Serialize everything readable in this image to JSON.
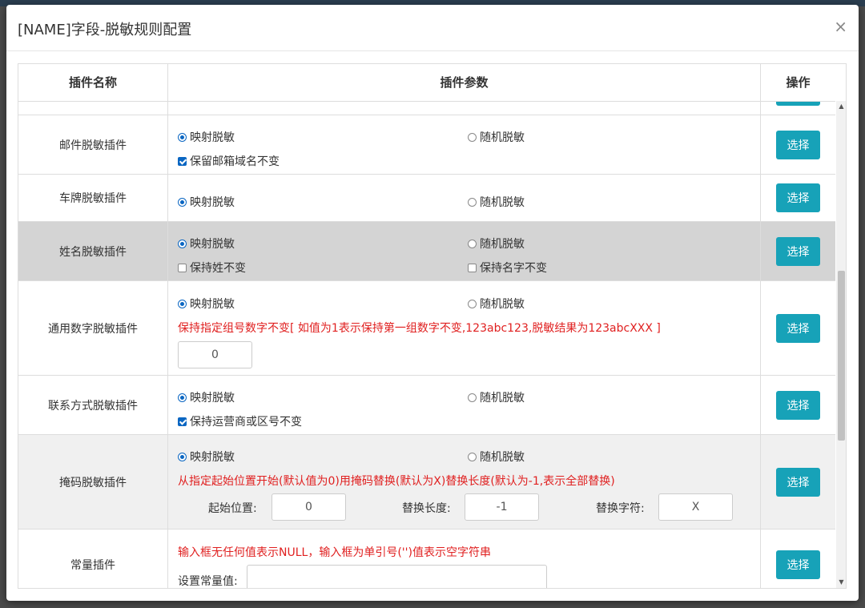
{
  "modal": {
    "title": "[NAME]字段-脱敏规则配置",
    "close": "×"
  },
  "table": {
    "headers": [
      "插件名称",
      "插件参数",
      "操作"
    ]
  },
  "labels": {
    "map": "映射脱敏",
    "random": "随机脱敏",
    "select": "选择"
  },
  "rows": {
    "email": {
      "name": "邮件脱敏插件",
      "check1": "保留邮箱域名不变"
    },
    "plate": {
      "name": "车牌脱敏插件"
    },
    "person": {
      "name": "姓名脱敏插件",
      "check1": "保持姓不变",
      "check2": "保持名字不变"
    },
    "number": {
      "name": "通用数字脱敏插件",
      "hint": "保持指定组号数字不变[ 如值为1表示保持第一组数字不变,123abc123,脱敏结果为123abcXXX ]",
      "value": "0"
    },
    "contact": {
      "name": "联系方式脱敏插件",
      "check1": "保持运营商或区号不变"
    },
    "mask": {
      "name": "掩码脱敏插件",
      "hint": "从指定起始位置开始(默认值为0)用掩码替换(默认为X)替换长度(默认为-1,表示全部替换)",
      "start_label": "起始位置:",
      "start_value": "0",
      "len_label": "替换长度:",
      "len_value": "-1",
      "char_label": "替换字符:",
      "char_value": "X"
    },
    "const": {
      "name": "常量插件",
      "hint": "输入框无任何值表示NULL，输入框为单引号('')值表示空字符串",
      "set_label": "设置常量值:",
      "value": ""
    }
  },
  "colors": {
    "accent": "#17a2b8",
    "hint": "#e02020",
    "radio": "#0a66c2"
  }
}
